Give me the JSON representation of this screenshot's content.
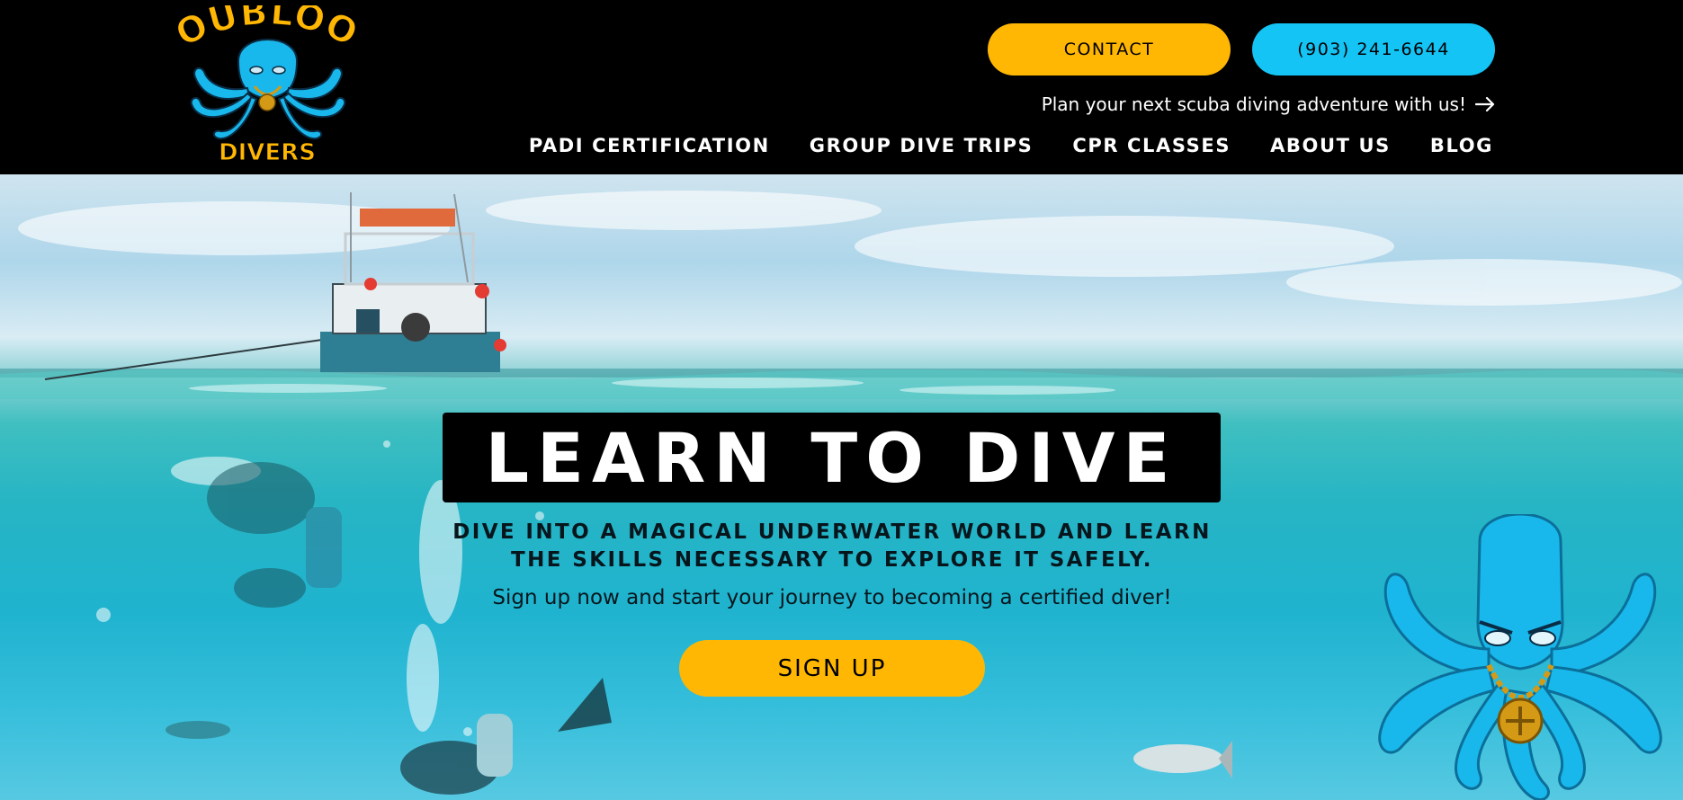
{
  "header": {
    "logo": {
      "top_text": "DOUBLOON",
      "bottom_text": "DIVERS"
    },
    "contact_label": "CONTACT",
    "phone_label": "(903) 241-6644",
    "plan_text": "Plan your next scuba diving adventure with us!",
    "plan_icon": "arrow-right-icon",
    "nav": [
      {
        "label": "PADI CERTIFICATION"
      },
      {
        "label": "GROUP DIVE TRIPS"
      },
      {
        "label": "CPR CLASSES"
      },
      {
        "label": "ABOUT US"
      },
      {
        "label": "BLOG"
      }
    ]
  },
  "hero": {
    "title": "LEARN TO DIVE",
    "subtitle": "DIVE INTO A MAGICAL UNDERWATER WORLD AND LEARN THE SKILLS NECESSARY TO EXPLORE IT SAFELY.",
    "tagline": "Sign up now and start your journey to becoming a certified diver!",
    "signup_label": "SIGN UP"
  },
  "colors": {
    "header_bg": "#000000",
    "accent_yellow": "#ffb703",
    "accent_blue": "#13c4f5",
    "octopus_blue": "#19b8ec",
    "gold": "#d49a16"
  }
}
